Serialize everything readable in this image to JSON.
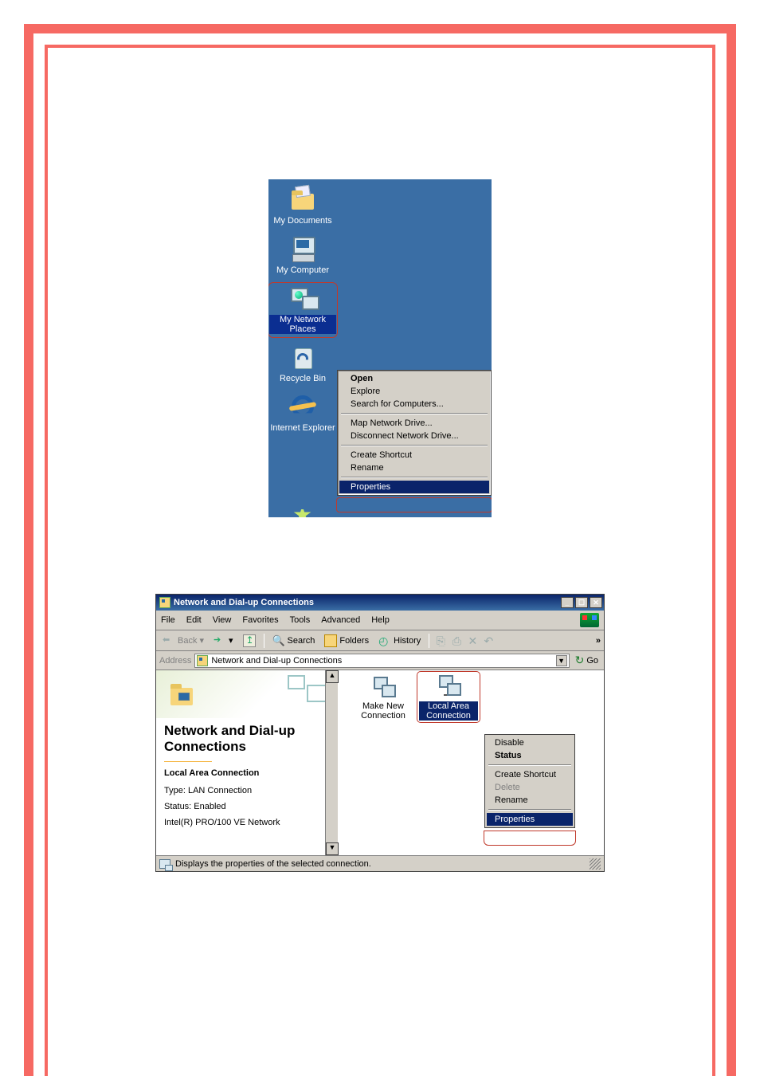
{
  "desktop": {
    "icons": [
      {
        "name": "my-documents",
        "label": "My Documents"
      },
      {
        "name": "my-computer",
        "label": "My Computer"
      },
      {
        "name": "my-network-places",
        "label": "My Network Places",
        "highlighted": true
      },
      {
        "name": "recycle-bin",
        "label": "Recycle Bin"
      },
      {
        "name": "internet-explorer",
        "label": "Internet Explorer"
      }
    ],
    "context_menu": {
      "items": [
        {
          "label": "Open",
          "bold": true
        },
        {
          "label": "Explore"
        },
        {
          "label": "Search for Computers..."
        },
        {
          "separator": true
        },
        {
          "label": "Map Network Drive..."
        },
        {
          "label": "Disconnect Network Drive..."
        },
        {
          "separator": true
        },
        {
          "label": "Create Shortcut"
        },
        {
          "label": "Rename"
        },
        {
          "separator": true
        },
        {
          "label": "Properties",
          "highlighted": true
        }
      ]
    }
  },
  "explorer": {
    "title": "Network and Dial-up Connections",
    "menus": [
      "File",
      "Edit",
      "View",
      "Favorites",
      "Tools",
      "Advanced",
      "Help"
    ],
    "toolbar": {
      "back": "Back",
      "search": "Search",
      "folders": "Folders",
      "history": "History",
      "more": "»"
    },
    "address": {
      "label": "Address",
      "value": "Network and Dial-up Connections",
      "go": "Go"
    },
    "leftpane": {
      "heading": "Network and Dial-up Connections",
      "subheading": "Local Area Connection",
      "type": "Type: LAN Connection",
      "status": "Status: Enabled",
      "adapter": "Intel(R) PRO/100 VE Network"
    },
    "icons": {
      "make_new": "Make New Connection",
      "lan": "Local Area Connection"
    },
    "context_menu": {
      "items": [
        {
          "label": "Disable"
        },
        {
          "label": "Status",
          "bold": true
        },
        {
          "separator": true
        },
        {
          "label": "Create Shortcut"
        },
        {
          "label": "Delete",
          "disabled": true
        },
        {
          "label": "Rename"
        },
        {
          "separator": true
        },
        {
          "label": "Properties",
          "highlighted": true
        }
      ]
    },
    "statusbar": "Displays the properties of the selected connection."
  }
}
